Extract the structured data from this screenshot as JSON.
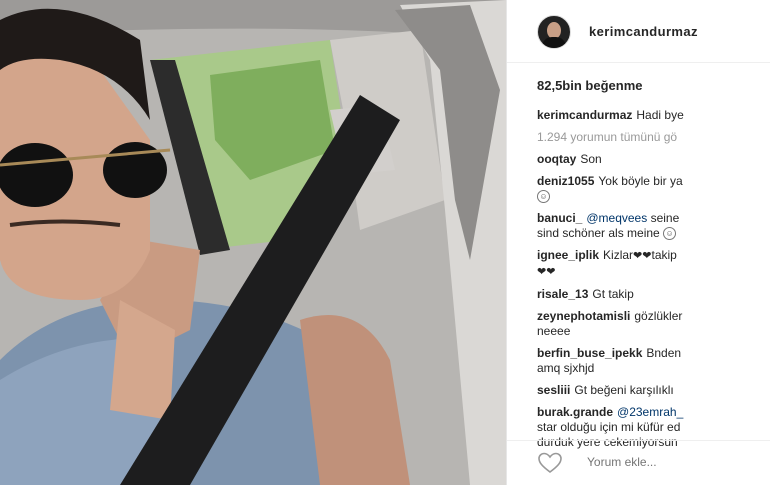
{
  "post": {
    "username": "kerimcandurmaz",
    "likes": "82,5bin beğenme",
    "caption_user": "kerimcandurmaz",
    "caption_text": "Hadi bye",
    "view_all": "1.294 yorumun tümünü gö",
    "comment_placeholder": "Yorum ekle..."
  },
  "comments": [
    {
      "user": "ooqtay",
      "lines": [
        "Son"
      ]
    },
    {
      "user": "deniz1055",
      "lines": [
        "Yok böyle bir ya",
        ""
      ]
    },
    {
      "user": "banuci_",
      "mention": "@meqvees",
      "lines": [
        "seine",
        "sind schöner als meine"
      ]
    },
    {
      "user": "ignee_iplik",
      "lines": [
        "Kizlar",
        "takip"
      ]
    },
    {
      "user": "risale_13",
      "lines": [
        "Gt takip"
      ]
    },
    {
      "user": "zeynephotamisli",
      "lines": [
        "gözlükler",
        "neeee"
      ]
    },
    {
      "user": "berfin_buse_ipekk",
      "lines": [
        "Bnden",
        "amq sjxhjd"
      ]
    },
    {
      "user": "sesliii",
      "lines": [
        "Gt beğeni karşılıklı"
      ]
    },
    {
      "user": "burak.grande",
      "mention": "@23emrah_",
      "lines": [
        "star olduğu için mi küfür ed",
        "durduk yere cekemiyorsun"
      ]
    }
  ],
  "colors": {
    "text": "#262626",
    "muted": "#999999",
    "mention": "#003569"
  },
  "icons": {
    "like": "heart-outline-icon",
    "avatar": "profile-avatar"
  }
}
